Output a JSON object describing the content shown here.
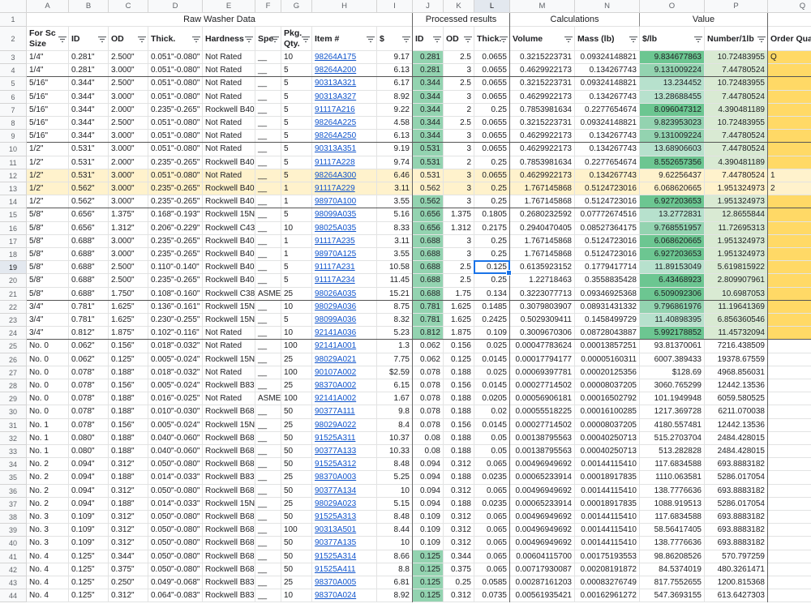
{
  "columns": [
    "A",
    "B",
    "C",
    "D",
    "E",
    "F",
    "G",
    "H",
    "I",
    "J",
    "K",
    "L",
    "M",
    "N",
    "O",
    "P",
    "Q"
  ],
  "groups": {
    "raw": "Raw Washer Data",
    "processed": "Processed results",
    "calculations": "Calculations",
    "value": "Value"
  },
  "headers": [
    "For Sc\nSize",
    "ID",
    "OD",
    "Thick.",
    "Hardness",
    "Spe",
    "Pkg.\nQty.",
    "Item #",
    "$",
    "ID",
    "OD",
    "Thick.",
    "Volume",
    "Mass (lb)",
    "$/lb",
    "Number/1lb",
    "Order Quant"
  ],
  "rows": [
    {
      "n": "3",
      "c": [
        "1/4\"",
        "0.281\"",
        "2.500\"",
        "0.051\"-0.080\"",
        "Not Rated",
        "__",
        "10",
        "98264A175",
        "9.17",
        "0.281",
        "2.5",
        "0.0655",
        "0.3215223731",
        "0.09324148821",
        "9.834677863",
        "10.72483955",
        "Q"
      ]
    },
    {
      "n": "4",
      "c": [
        "1/4\"",
        "0.281\"",
        "3.000\"",
        "0.051\"-0.080\"",
        "Not Rated",
        "__",
        "5",
        "98264A200",
        "6.13",
        "0.281",
        "3",
        "0.0655",
        "0.4629922173",
        "0.134267743",
        "9.131009224",
        "7.44780524",
        ""
      ]
    },
    {
      "n": "5",
      "c": [
        "5/16\"",
        "0.344\"",
        "2.500\"",
        "0.051\"-0.080\"",
        "Not Rated",
        "__",
        "5",
        "90313A321",
        "6.17",
        "0.344",
        "2.5",
        "0.0655",
        "0.3215223731",
        "0.09324148821",
        "13.234452",
        "10.72483955",
        ""
      ]
    },
    {
      "n": "6",
      "c": [
        "5/16\"",
        "0.344\"",
        "3.000\"",
        "0.051\"-0.080\"",
        "Not Rated",
        "__",
        "5",
        "90313A327",
        "8.92",
        "0.344",
        "3",
        "0.0655",
        "0.4629922173",
        "0.134267743",
        "13.28688455",
        "7.44780524",
        ""
      ]
    },
    {
      "n": "7",
      "c": [
        "5/16\"",
        "0.344\"",
        "2.000\"",
        "0.235\"-0.265\"",
        "Rockwell B40",
        "__",
        "5",
        "91117A216",
        "9.22",
        "0.344",
        "2",
        "0.25",
        "0.7853981634",
        "0.2277654674",
        "8.096047312",
        "4.390481189",
        ""
      ]
    },
    {
      "n": "8",
      "c": [
        "5/16\"",
        "0.344\"",
        "2.500\"",
        "0.051\"-0.080\"",
        "Not Rated",
        "__",
        "5",
        "98264A225",
        "4.58",
        "0.344",
        "2.5",
        "0.0655",
        "0.3215223731",
        "0.09324148821",
        "9.823953023",
        "10.72483955",
        ""
      ]
    },
    {
      "n": "9",
      "c": [
        "5/16\"",
        "0.344\"",
        "3.000\"",
        "0.051\"-0.080\"",
        "Not Rated",
        "__",
        "5",
        "98264A250",
        "6.13",
        "0.344",
        "3",
        "0.0655",
        "0.4629922173",
        "0.134267743",
        "9.131009224",
        "7.44780524",
        ""
      ]
    },
    {
      "n": "10",
      "c": [
        "1/2\"",
        "0.531\"",
        "3.000\"",
        "0.051\"-0.080\"",
        "Not Rated",
        "__",
        "5",
        "90313A351",
        "9.19",
        "0.531",
        "3",
        "0.0655",
        "0.4629922173",
        "0.134267743",
        "13.68906603",
        "7.44780524",
        ""
      ]
    },
    {
      "n": "11",
      "c": [
        "1/2\"",
        "0.531\"",
        "2.000\"",
        "0.235\"-0.265\"",
        "Rockwell B40",
        "__",
        "5",
        "91117A228",
        "9.74",
        "0.531",
        "2",
        "0.25",
        "0.7853981634",
        "0.2277654674",
        "8.552657356",
        "4.390481189",
        ""
      ]
    },
    {
      "n": "12",
      "c": [
        "1/2\"",
        "0.531\"",
        "3.000\"",
        "0.051\"-0.080\"",
        "Not Rated",
        "__",
        "5",
        "98264A300",
        "6.46",
        "0.531",
        "3",
        "0.0655",
        "0.4629922173",
        "0.134267743",
        "9.62256437",
        "7.44780524",
        "1"
      ]
    },
    {
      "n": "13",
      "c": [
        "1/2\"",
        "0.562\"",
        "3.000\"",
        "0.235\"-0.265\"",
        "Rockwell B40",
        "__",
        "1",
        "91117A229",
        "3.11",
        "0.562",
        "3",
        "0.25",
        "1.767145868",
        "0.5124723016",
        "6.068620665",
        "1.951324973",
        "2"
      ]
    },
    {
      "n": "14",
      "c": [
        "1/2\"",
        "0.562\"",
        "3.000\"",
        "0.235\"-0.265\"",
        "Rockwell B40",
        "__",
        "1",
        "98970A100",
        "3.55",
        "0.562",
        "3",
        "0.25",
        "1.767145868",
        "0.5124723016",
        "6.927203653",
        "1.951324973",
        ""
      ]
    },
    {
      "n": "15",
      "c": [
        "5/8\"",
        "0.656\"",
        "1.375\"",
        "0.168\"-0.193\"",
        "Rockwell 15N8",
        "__",
        "5",
        "98099A035",
        "5.16",
        "0.656",
        "1.375",
        "0.1805",
        "0.2680232592",
        "0.07772674516",
        "13.2772831",
        "12.8655844",
        ""
      ]
    },
    {
      "n": "16",
      "c": [
        "5/8\"",
        "0.656\"",
        "1.312\"",
        "0.206\"-0.229\"",
        "Rockwell C43",
        "__",
        "10",
        "98025A035",
        "8.33",
        "0.656",
        "1.312",
        "0.2175",
        "0.2940470405",
        "0.08527364175",
        "9.768551957",
        "11.72695313",
        ""
      ]
    },
    {
      "n": "17",
      "c": [
        "5/8\"",
        "0.688\"",
        "3.000\"",
        "0.235\"-0.265\"",
        "Rockwell B40",
        "__",
        "1",
        "91117A235",
        "3.11",
        "0.688",
        "3",
        "0.25",
        "1.767145868",
        "0.5124723016",
        "6.068620665",
        "1.951324973",
        ""
      ]
    },
    {
      "n": "18",
      "c": [
        "5/8\"",
        "0.688\"",
        "3.000\"",
        "0.235\"-0.265\"",
        "Rockwell B40",
        "__",
        "1",
        "98970A125",
        "3.55",
        "0.688",
        "3",
        "0.25",
        "1.767145868",
        "0.5124723016",
        "6.927203653",
        "1.951324973",
        ""
      ]
    },
    {
      "n": "19",
      "c": [
        "5/8\"",
        "0.688\"",
        "2.500\"",
        "0.110\"-0.140\"",
        "Rockwell B40",
        "__",
        "5",
        "91117A231",
        "10.58",
        "0.688",
        "2.5",
        "0.125",
        "0.6135923152",
        "0.1779417714",
        "11.89153049",
        "5.619815922",
        ""
      ]
    },
    {
      "n": "20",
      "c": [
        "5/8\"",
        "0.688\"",
        "2.500\"",
        "0.235\"-0.265\"",
        "Rockwell B40",
        "__",
        "5",
        "91117A234",
        "11.45",
        "0.688",
        "2.5",
        "0.25",
        "1.22718463",
        "0.3558835428",
        "6.43468923",
        "2.809907961",
        ""
      ]
    },
    {
      "n": "21",
      "c": [
        "5/8\"",
        "0.688\"",
        "1.750\"",
        "0.108\"-0.160\"",
        "Rockwell C38",
        "ASME",
        "25",
        "98026A035",
        "15.21",
        "0.688",
        "1.75",
        "0.134",
        "0.3223077713",
        "0.09346925368",
        "6.509092306",
        "10.6987053",
        ""
      ]
    },
    {
      "n": "22",
      "c": [
        "3/4\"",
        "0.781\"",
        "1.625\"",
        "0.136\"-0.161\"",
        "Rockwell 15N8",
        "__",
        "10",
        "98029A036",
        "8.75",
        "0.781",
        "1.625",
        "0.1485",
        "0.3079803907",
        "0.08931431332",
        "9.796861976",
        "11.19641369",
        ""
      ]
    },
    {
      "n": "23",
      "c": [
        "3/4\"",
        "0.781\"",
        "1.625\"",
        "0.230\"-0.255\"",
        "Rockwell 15N8",
        "__",
        "5",
        "98099A036",
        "8.32",
        "0.781",
        "1.625",
        "0.2425",
        "0.5029309411",
        "0.1458499729",
        "11.40898395",
        "6.856360546",
        ""
      ]
    },
    {
      "n": "24",
      "c": [
        "3/4\"",
        "0.812\"",
        "1.875\"",
        "0.102\"-0.116\"",
        "Not Rated",
        "__",
        "10",
        "92141A036",
        "5.23",
        "0.812",
        "1.875",
        "0.109",
        "0.3009670306",
        "0.08728043887",
        "5.992178852",
        "11.45732094",
        ""
      ]
    },
    {
      "n": "25",
      "c": [
        "No. 0",
        "0.062\"",
        "0.156\"",
        "0.018\"-0.032\"",
        "Not Rated",
        "__",
        "100",
        "92141A001",
        "1.3",
        "0.062",
        "0.156",
        "0.025",
        "0.00047783624",
        "0.00013857251",
        "93.81370061",
        "7216.438509",
        ""
      ]
    },
    {
      "n": "26",
      "c": [
        "No. 0",
        "0.062\"",
        "0.125\"",
        "0.005\"-0.024\"",
        "Rockwell 15N8",
        "__",
        "25",
        "98029A021",
        "7.75",
        "0.062",
        "0.125",
        "0.0145",
        "0.00017794177",
        "0.00005160311",
        "6007.389433",
        "19378.67559",
        ""
      ]
    },
    {
      "n": "27",
      "c": [
        "No. 0",
        "0.078\"",
        "0.188\"",
        "0.018\"-0.032\"",
        "Not Rated",
        "__",
        "100",
        "90107A002",
        "$2.59",
        "0.078",
        "0.188",
        "0.025",
        "0.00069397781",
        "0.00020125356",
        "$128.69",
        "4968.856031",
        ""
      ]
    },
    {
      "n": "28",
      "c": [
        "No. 0",
        "0.078\"",
        "0.156\"",
        "0.005\"-0.024\"",
        "Rockwell B83",
        "__",
        "25",
        "98370A002",
        "6.15",
        "0.078",
        "0.156",
        "0.0145",
        "0.00027714502",
        "0.00008037205",
        "3060.765299",
        "12442.13536",
        ""
      ]
    },
    {
      "n": "29",
      "c": [
        "No. 0",
        "0.078\"",
        "0.188\"",
        "0.016\"-0.025\"",
        "Not Rated",
        "ASME",
        "100",
        "92141A002",
        "1.67",
        "0.078",
        "0.188",
        "0.0205",
        "0.00056906181",
        "0.00016502792",
        "101.1949948",
        "6059.580525",
        ""
      ]
    },
    {
      "n": "30",
      "c": [
        "No. 0",
        "0.078\"",
        "0.188\"",
        "0.010\"-0.030\"",
        "Rockwell B68",
        "__",
        "50",
        "90377A111",
        "9.8",
        "0.078",
        "0.188",
        "0.02",
        "0.00055518225",
        "0.00016100285",
        "1217.369728",
        "6211.070038",
        ""
      ]
    },
    {
      "n": "31",
      "c": [
        "No. 1",
        "0.078\"",
        "0.156\"",
        "0.005\"-0.024\"",
        "Rockwell 15N8",
        "__",
        "25",
        "98029A022",
        "8.4",
        "0.078",
        "0.156",
        "0.0145",
        "0.00027714502",
        "0.00008037205",
        "4180.557481",
        "12442.13536",
        ""
      ]
    },
    {
      "n": "32",
      "c": [
        "No. 1",
        "0.080\"",
        "0.188\"",
        "0.040\"-0.060\"",
        "Rockwell B68",
        "__",
        "50",
        "91525A311",
        "10.37",
        "0.08",
        "0.188",
        "0.05",
        "0.00138795563",
        "0.00040250713",
        "515.2703704",
        "2484.428015",
        ""
      ]
    },
    {
      "n": "33",
      "c": [
        "No. 1",
        "0.080\"",
        "0.188\"",
        "0.040\"-0.060\"",
        "Rockwell B68",
        "__",
        "50",
        "90377A133",
        "10.33",
        "0.08",
        "0.188",
        "0.05",
        "0.00138795563",
        "0.00040250713",
        "513.282828",
        "2484.428015",
        ""
      ]
    },
    {
      "n": "34",
      "c": [
        "No. 2",
        "0.094\"",
        "0.312\"",
        "0.050\"-0.080\"",
        "Rockwell B68",
        "__",
        "50",
        "91525A312",
        "8.48",
        "0.094",
        "0.312",
        "0.065",
        "0.00496949692",
        "0.00144115410",
        "117.6834588",
        "693.8883182",
        ""
      ]
    },
    {
      "n": "35",
      "c": [
        "No. 2",
        "0.094\"",
        "0.188\"",
        "0.014\"-0.033\"",
        "Rockwell B83",
        "__",
        "25",
        "98370A003",
        "5.25",
        "0.094",
        "0.188",
        "0.0235",
        "0.00065233914",
        "0.00018917835",
        "1110.063581",
        "5286.017054",
        ""
      ]
    },
    {
      "n": "36",
      "c": [
        "No. 2",
        "0.094\"",
        "0.312\"",
        "0.050\"-0.080\"",
        "Rockwell B68",
        "__",
        "50",
        "90377A134",
        "10",
        "0.094",
        "0.312",
        "0.065",
        "0.00496949692",
        "0.00144115410",
        "138.7776636",
        "693.8883182",
        ""
      ]
    },
    {
      "n": "37",
      "c": [
        "No. 2",
        "0.094\"",
        "0.188\"",
        "0.014\"-0.033\"",
        "Rockwell 15N8",
        "__",
        "25",
        "98029A023",
        "5.15",
        "0.094",
        "0.188",
        "0.0235",
        "0.00065233914",
        "0.00018917835",
        "1088.919513",
        "5286.017054",
        ""
      ]
    },
    {
      "n": "38",
      "c": [
        "No. 3",
        "0.109\"",
        "0.312\"",
        "0.050\"-0.080\"",
        "Rockwell B68",
        "__",
        "50",
        "91525A313",
        "8.48",
        "0.109",
        "0.312",
        "0.065",
        "0.00496949692",
        "0.00144115410",
        "117.6834588",
        "693.8883182",
        ""
      ]
    },
    {
      "n": "39",
      "c": [
        "No. 3",
        "0.109\"",
        "0.312\"",
        "0.050\"-0.080\"",
        "Rockwell B68",
        "__",
        "100",
        "90313A501",
        "8.44",
        "0.109",
        "0.312",
        "0.065",
        "0.00496949692",
        "0.00144115410",
        "58.56417405",
        "693.8883182",
        ""
      ]
    },
    {
      "n": "40",
      "c": [
        "No. 3",
        "0.109\"",
        "0.312\"",
        "0.050\"-0.080\"",
        "Rockwell B68",
        "__",
        "50",
        "90377A135",
        "10",
        "0.109",
        "0.312",
        "0.065",
        "0.00496949692",
        "0.00144115410",
        "138.7776636",
        "693.8883182",
        ""
      ]
    },
    {
      "n": "41",
      "c": [
        "No. 4",
        "0.125\"",
        "0.344\"",
        "0.050\"-0.080\"",
        "Rockwell B68",
        "__",
        "50",
        "91525A314",
        "8.66",
        "0.125",
        "0.344",
        "0.065",
        "0.00604115700",
        "0.00175193553",
        "98.86208526",
        "570.797259",
        ""
      ]
    },
    {
      "n": "42",
      "c": [
        "No. 4",
        "0.125\"",
        "0.375\"",
        "0.050\"-0.080\"",
        "Rockwell B68",
        "__",
        "50",
        "91525A411",
        "8.8",
        "0.125",
        "0.375",
        "0.065",
        "0.00717930087",
        "0.00208191872",
        "84.5374019",
        "480.3261471",
        ""
      ]
    },
    {
      "n": "43",
      "c": [
        "No. 4",
        "0.125\"",
        "0.250\"",
        "0.049\"-0.068\"",
        "Rockwell B83",
        "__",
        "25",
        "98370A005",
        "6.81",
        "0.125",
        "0.25",
        "0.0585",
        "0.00287161203",
        "0.00083276749",
        "817.7552655",
        "1200.815368",
        ""
      ]
    },
    {
      "n": "44",
      "c": [
        "No. 4",
        "0.125\"",
        "0.312\"",
        "0.064\"-0.083\"",
        "Rockwell B83",
        "__",
        "10",
        "98370A024",
        "8.92",
        "0.125",
        "0.312",
        "0.0735",
        "0.00561935421",
        "0.00162961272",
        "547.3693155",
        "613.6427303",
        ""
      ]
    }
  ]
}
